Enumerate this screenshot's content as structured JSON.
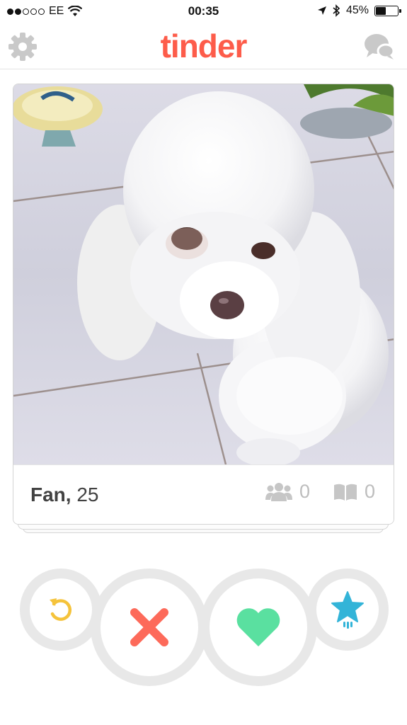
{
  "status_bar": {
    "carrier": "EE",
    "time": "00:35",
    "battery_percent": "45%",
    "battery_level": 0.45,
    "signal_bars_filled": 2,
    "signal_bars_total": 5
  },
  "nav": {
    "logo": "tinder",
    "left_icon": "gear-icon",
    "right_icon": "chat-bubbles-icon"
  },
  "card": {
    "name": "Fan,",
    "age": "25",
    "common_friends": "0",
    "common_interests": "0",
    "photo_subject": "white-poodle-photo"
  },
  "actions": {
    "rewind_icon": "rewind-icon",
    "nope_icon": "x-icon",
    "like_icon": "heart-icon",
    "superlike_icon": "star-icon"
  },
  "colors": {
    "brand": "#fd5c4a",
    "nope": "#fd6a5a",
    "like": "#5ae0a0",
    "superlike": "#33b4d8",
    "rewind": "#f5c33b",
    "ring": "#e8e8e8"
  }
}
